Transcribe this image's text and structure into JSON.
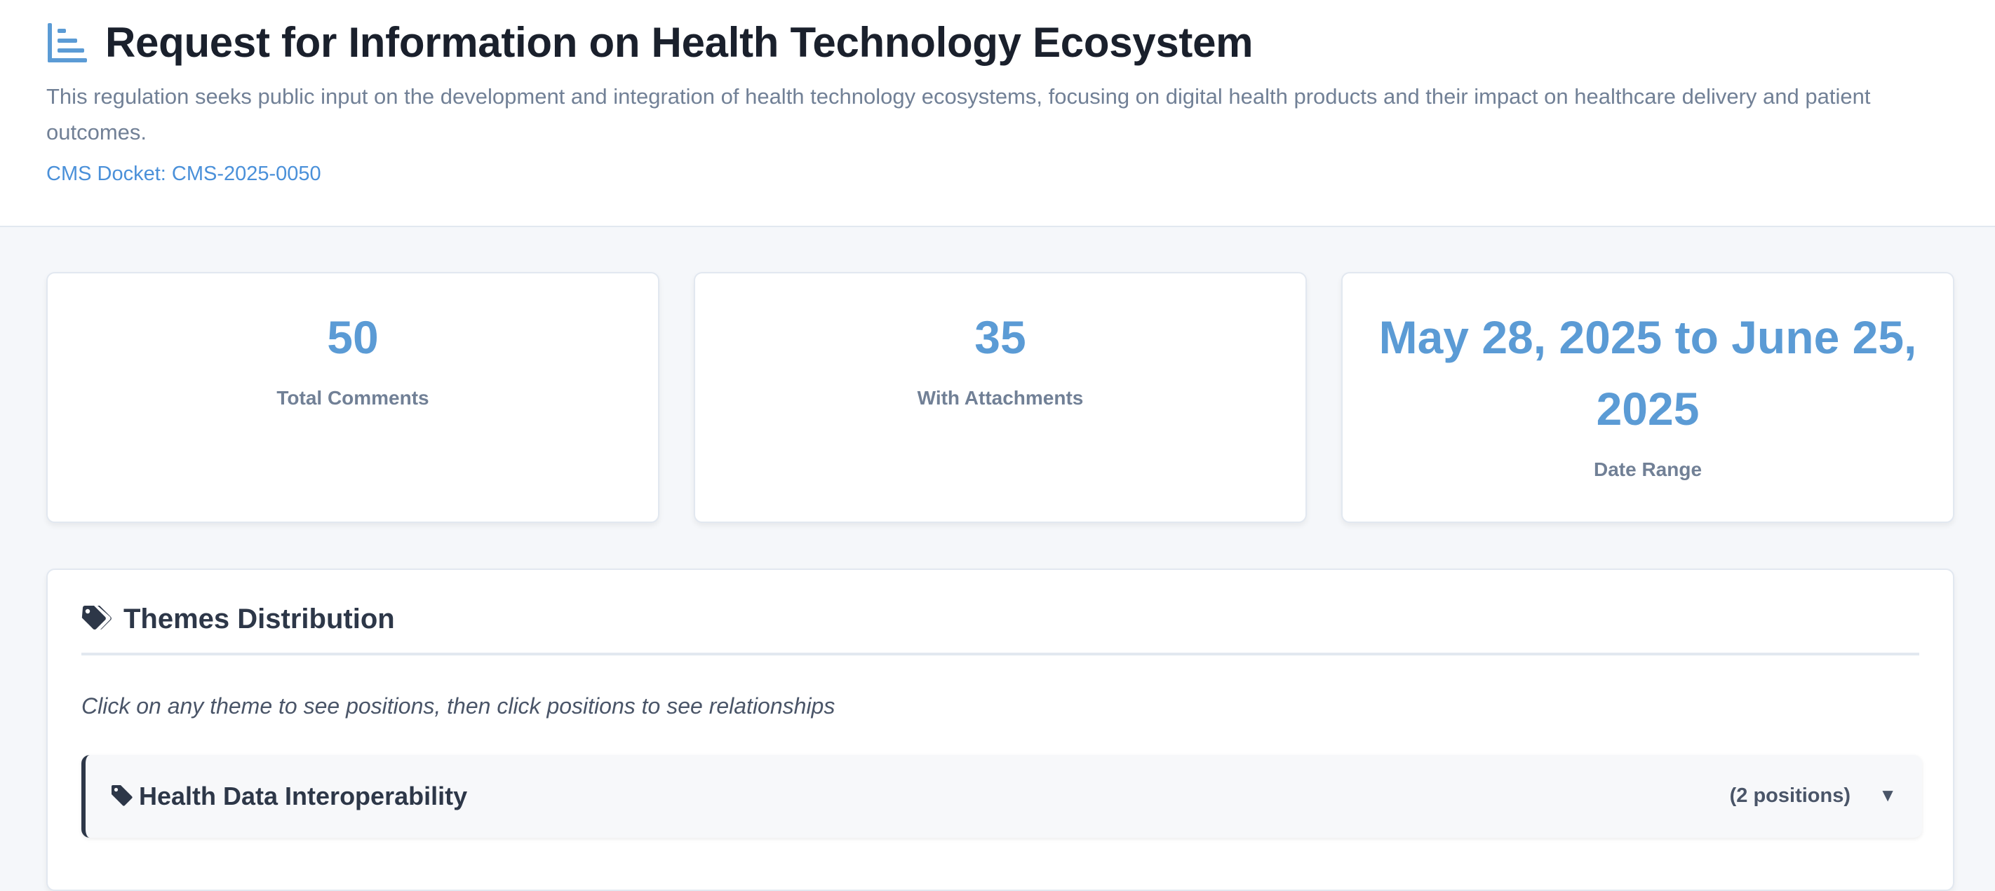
{
  "header": {
    "title": "Request for Information on Health Technology Ecosystem",
    "title_icon": "chart-bar-icon",
    "description": "This regulation seeks public input on the development and integration of health technology ecosystems, focusing on digital health products and their impact on healthcare delivery and patient outcomes.",
    "docket": "CMS Docket: CMS-2025-0050"
  },
  "stats": [
    {
      "value": "50",
      "label": "Total Comments"
    },
    {
      "value": "35",
      "label": "With Attachments"
    },
    {
      "value": "May 28, 2025 to June 25, 2025",
      "label": "Date Range"
    }
  ],
  "themes": {
    "title": "Themes Distribution",
    "icon": "tags-icon",
    "hint": "Click on any theme to see positions, then click positions to see relationships",
    "items": [
      {
        "name": "Health Data Interoperability",
        "count": "(2 positions)",
        "icon": "tag-icon",
        "chevron": "▼"
      }
    ]
  },
  "colors": {
    "accent": "#5b9bd5",
    "link": "#4a90d9",
    "background": "#f5f7fa",
    "text_dark": "#1a202c",
    "text_muted": "#718096"
  }
}
